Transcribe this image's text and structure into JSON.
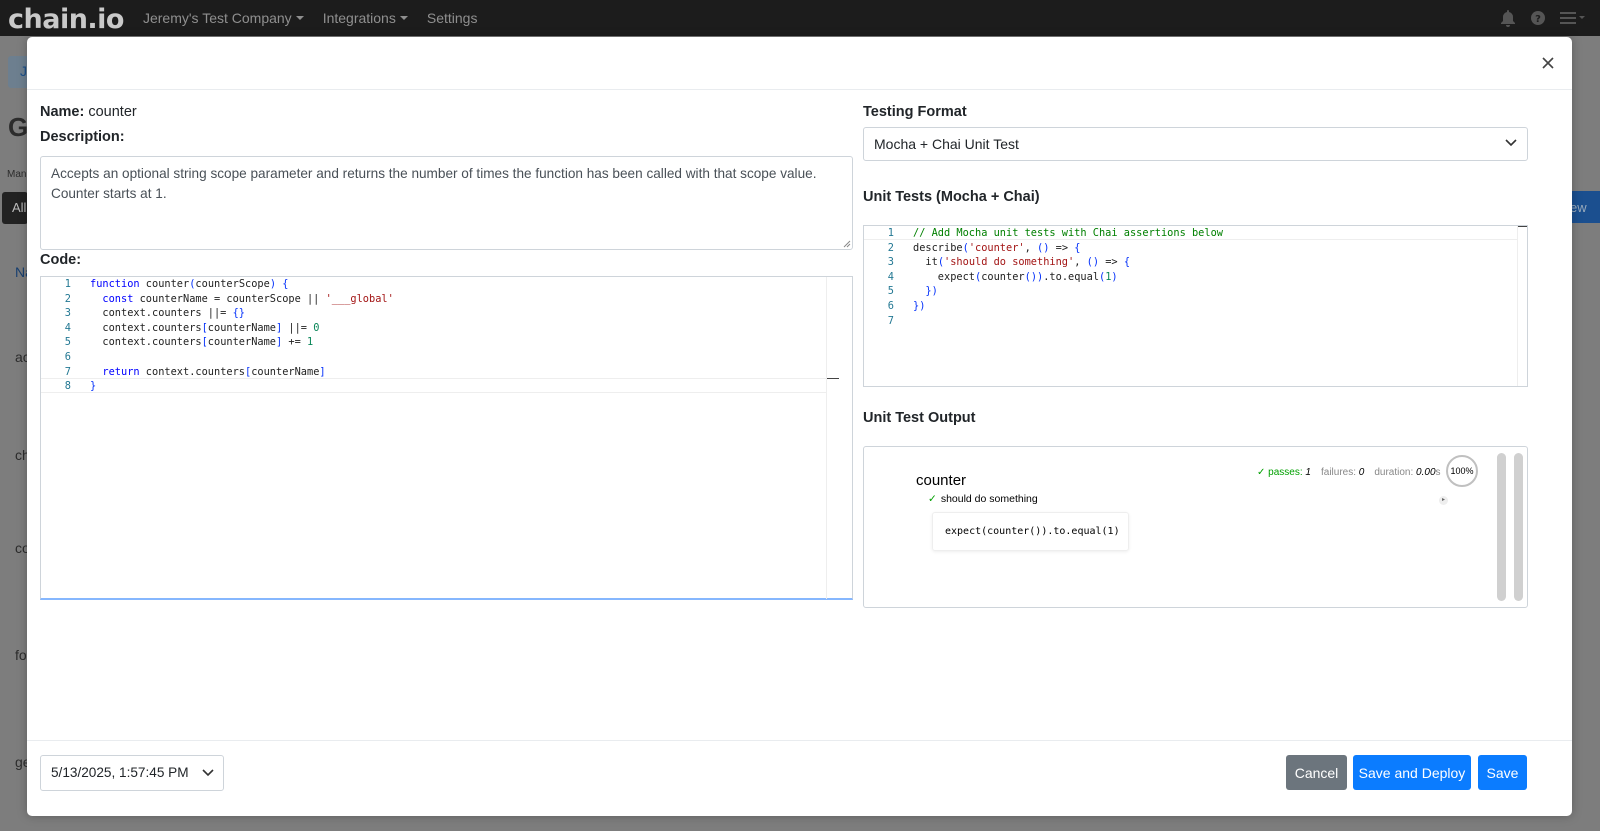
{
  "navbar": {
    "logo": "chain.io",
    "company": "Jeremy's Test Company",
    "integrations": "Integrations",
    "settings": "Settings"
  },
  "background": {
    "fragments": [
      "J",
      "G",
      "Man",
      "All",
      "ew",
      "Na",
      "ac",
      "ch",
      "co",
      "fo",
      "ge"
    ]
  },
  "modal": {
    "name_label": "Name:",
    "name_value": "counter",
    "description_label": "Description:",
    "description": "Accepts an optional string scope parameter and returns the number of times the function has been called with that scope value. Counter starts at 1.",
    "code_label": "Code:",
    "code_lines": [
      {
        "n": "1",
        "text": "function counter(counterScope) {"
      },
      {
        "n": "2",
        "text": "  const counterName = counterScope || '___global'"
      },
      {
        "n": "3",
        "text": "  context.counters ||= {}"
      },
      {
        "n": "4",
        "text": "  context.counters[counterName] ||= 0"
      },
      {
        "n": "5",
        "text": "  context.counters[counterName] += 1"
      },
      {
        "n": "6",
        "text": ""
      },
      {
        "n": "7",
        "text": "  return context.counters[counterName]"
      },
      {
        "n": "8",
        "text": "}"
      }
    ],
    "testing_format_label": "Testing Format",
    "testing_format_value": "Mocha + Chai Unit Test",
    "unit_tests_label": "Unit Tests (Mocha + Chai)",
    "test_lines": [
      {
        "n": "1",
        "text": "// Add Mocha unit tests with Chai assertions below"
      },
      {
        "n": "2",
        "text": "describe('counter', () => {"
      },
      {
        "n": "3",
        "text": "  it('should do something', () => {"
      },
      {
        "n": "4",
        "text": "    expect(counter()).to.equal(1)"
      },
      {
        "n": "5",
        "text": "  })"
      },
      {
        "n": "6",
        "text": "})"
      },
      {
        "n": "7",
        "text": ""
      }
    ],
    "output_label": "Unit Test Output",
    "output": {
      "passes_label": "passes:",
      "passes": "1",
      "failures_label": "failures:",
      "failures": "0",
      "duration_label": "duration:",
      "duration": "0.00",
      "duration_unit": "s",
      "progress": "100%",
      "suite": "counter",
      "test": "should do something",
      "snippet": "expect(counter()).to.equal(1)"
    },
    "footer": {
      "version_date": "5/13/2025, 1:57:45 PM",
      "cancel": "Cancel",
      "save_deploy": "Save and Deploy",
      "save": "Save"
    }
  },
  "colors": {
    "primary": "#0b7cff",
    "secondary": "#6c757d",
    "navbar": "#1c1c1c",
    "pass": "#00a000"
  }
}
